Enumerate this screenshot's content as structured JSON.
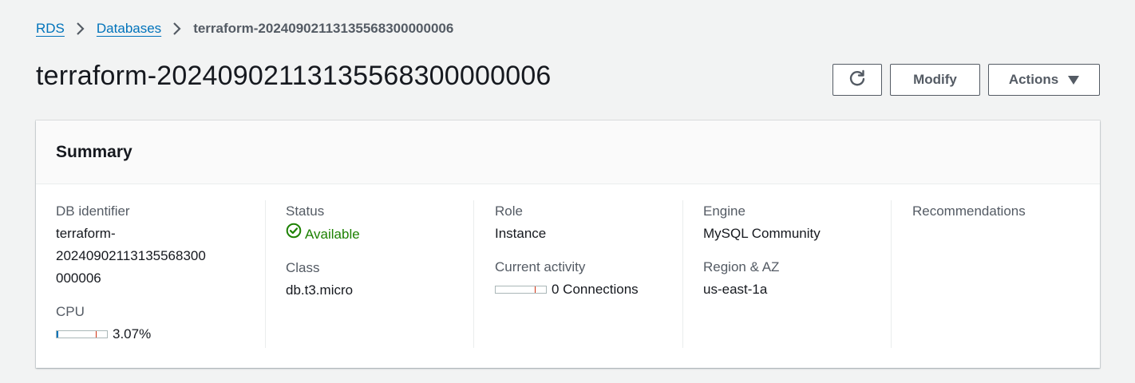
{
  "breadcrumb": {
    "items": [
      "RDS",
      "Databases"
    ],
    "current": "terraform-20240902113135568300000006"
  },
  "page": {
    "title": "terraform-20240902113135568300000006"
  },
  "header_actions": {
    "refresh_icon": "refresh-icon",
    "modify_label": "Modify",
    "actions_label": "Actions"
  },
  "summary": {
    "title": "Summary",
    "db_identifier": {
      "label": "DB identifier",
      "line1": "terraform-",
      "line2": "202409021131355683​00",
      "line3": "000006"
    },
    "cpu": {
      "label": "CPU",
      "value": "3.07%",
      "fraction": 0.0307
    },
    "status": {
      "label": "Status",
      "value": "Available",
      "color": "#1d8102"
    },
    "class": {
      "label": "Class",
      "value": "db.t3.micro"
    },
    "role": {
      "label": "Role",
      "value": "Instance"
    },
    "current_activity": {
      "label": "Current activity",
      "value": "0 Connections",
      "fraction": 0
    },
    "engine": {
      "label": "Engine",
      "value": "MySQL Community"
    },
    "region": {
      "label": "Region & AZ",
      "value": "us-east-1a"
    },
    "recommendations": {
      "label": "Recommendations"
    }
  },
  "colors": {
    "link": "#0073bb",
    "success": "#1d8102",
    "threshold": "#d13212"
  }
}
